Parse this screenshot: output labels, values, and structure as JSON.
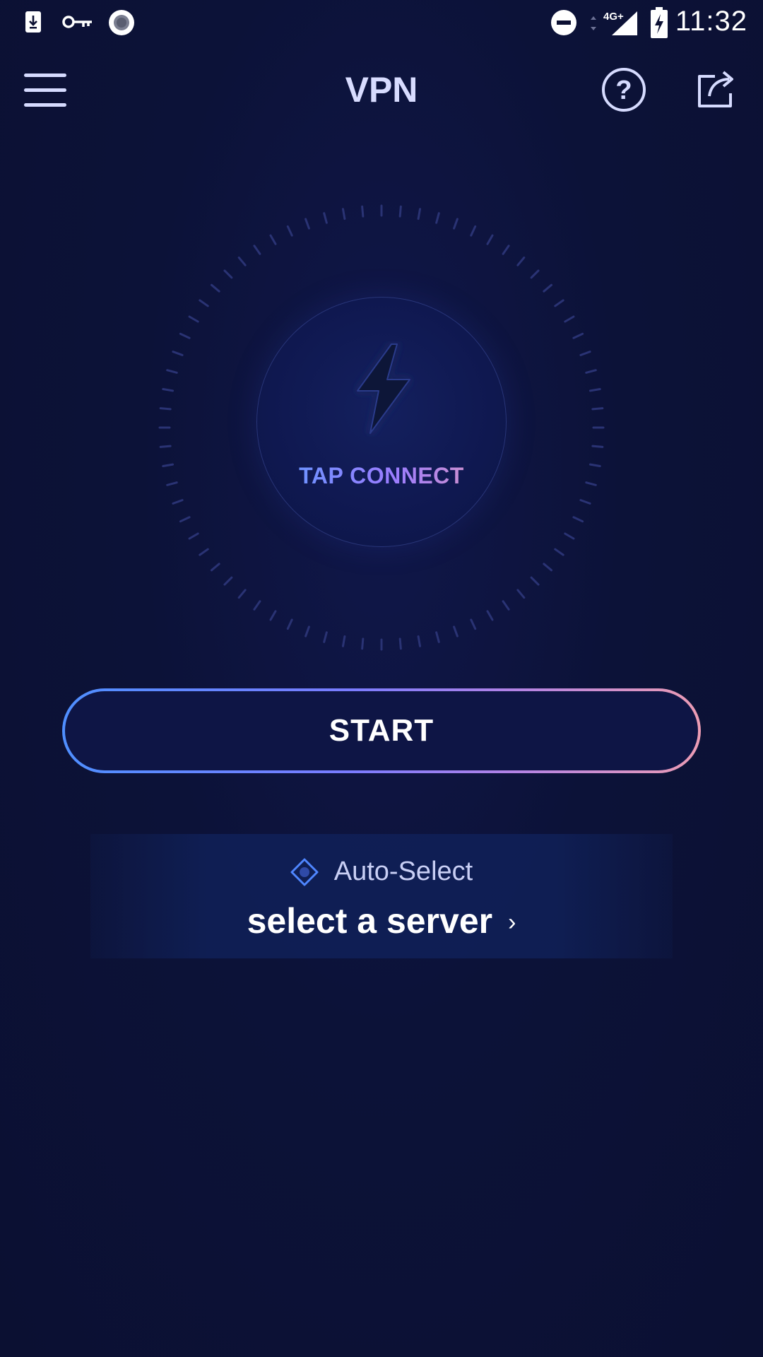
{
  "status_bar": {
    "time": "11:32",
    "network": "4G+",
    "icons": [
      "download-icon",
      "vpn-key-icon",
      "record-icon",
      "do-not-disturb-icon",
      "signal-icon",
      "battery-charging-icon"
    ]
  },
  "app_bar": {
    "title": "VPN",
    "icons": [
      "menu-icon",
      "help-icon",
      "share-icon"
    ]
  },
  "connect": {
    "label": "TAP CONNECT",
    "icon": "lightning-bolt-icon"
  },
  "start_button": {
    "label": "START"
  },
  "server": {
    "mode": "Auto-Select",
    "name": "select a server",
    "chevron": "›",
    "icon": "location-target-icon"
  },
  "colors": {
    "background": "#0c1033",
    "gradient_start": "#4f8fff",
    "gradient_mid": "#9b7cff",
    "gradient_end": "#ec9cb4",
    "title_text": "#d8dcff"
  }
}
